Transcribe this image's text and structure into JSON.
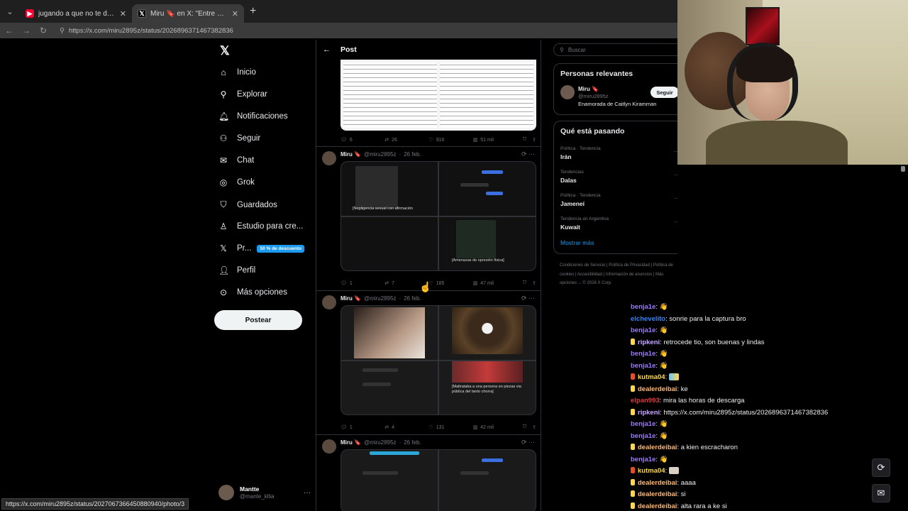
{
  "browser": {
    "tabs": [
      {
        "title": "jugando a que no te duele nada (\\",
        "active": false
      },
      {
        "title": "Miru 🔖 en X: \"Entre a tiktok y tu",
        "active": true
      }
    ],
    "url": "https://x.com/miru2895z/status/2026896371467382836",
    "status_url": "https://x.com/miru2895z/status/2027067366450880940/photo/3"
  },
  "nav": {
    "items": [
      {
        "label": "Inicio",
        "icon": "home-icon"
      },
      {
        "label": "Explorar",
        "icon": "search-icon"
      },
      {
        "label": "Notificaciones",
        "icon": "bell-icon"
      },
      {
        "label": "Seguir",
        "icon": "follow-icon"
      },
      {
        "label": "Chat",
        "icon": "mail-icon"
      },
      {
        "label": "Grok",
        "icon": "grok-icon"
      },
      {
        "label": "Guardados",
        "icon": "bookmark-icon"
      },
      {
        "label": "Estudio para cre...",
        "icon": "studio-icon"
      },
      {
        "label": "Pr...",
        "icon": "x-premium-icon"
      },
      {
        "label": "Perfil",
        "icon": "profile-icon"
      },
      {
        "label": "Más opciones",
        "icon": "more-icon"
      }
    ],
    "promo_badge": "50 % de descuento",
    "post_button": "Postear",
    "account_name": "Mantte",
    "account_handle": "@mante_kllia"
  },
  "feed": {
    "header_title": "Post",
    "first_actions": {
      "replies": "6",
      "reposts": "26",
      "likes": "916",
      "views": "51 mil"
    },
    "posts": [
      {
        "name": "Miru 🔖",
        "handle": "@miru2895z",
        "date": "26 feb.",
        "cap1": "[Negligencia sexual con afirmación",
        "cap2": "[Amenazas de opresión física]",
        "replies": "1",
        "reposts": "7",
        "likes": "185",
        "views": "47 mil"
      },
      {
        "name": "Miru 🔖",
        "handle": "@miru2895z",
        "date": "26 feb.",
        "cap1": "",
        "cap2": "[Maltrataba a una persona en piezas via pública del tanto chorra]",
        "replies": "1",
        "reposts": "4",
        "likes": "131",
        "views": "42 mil"
      },
      {
        "name": "Miru 🔖",
        "handle": "@miru2895z",
        "date": "26 feb."
      }
    ]
  },
  "right": {
    "search_placeholder": "Buscar",
    "relevant_title": "Personas relevantes",
    "relevant_name": "Miru 🔖",
    "relevant_handle": "@miru2895z",
    "relevant_bio": "Enamorada de Caitlyn Kiramman",
    "follow_label": "Seguir",
    "trending_title": "Qué está pasando",
    "trends": [
      {
        "context": "Política · Tendencia",
        "name": "Irán"
      },
      {
        "context": "Tendencias",
        "name": "Dalas"
      },
      {
        "context": "Política · Tendencia",
        "name": "Jameneí"
      },
      {
        "context": "Tendencia en Argentina",
        "name": "Kuwait"
      }
    ],
    "show_more": "Mostrar más",
    "footer": "Condiciones de Servicio  |  Política de Privacidad  |  Política de cookies  |  Accesibilidad  |  Información de anuncios  |  Más opciones ...  © 2026 X Corp."
  },
  "chat": {
    "messages": [
      {
        "user": "benja1e",
        "text": "👋",
        "color": "#9b7cf4"
      },
      {
        "user": "elchevelito",
        "text": "sonrie para la captura bro",
        "color": "#2e86ff"
      },
      {
        "user": "benja1e",
        "text": "👋",
        "color": "#9b7cf4"
      },
      {
        "user": "ripkeni",
        "text": "retrocede tio, son buenas y lindas",
        "color": "#c9a9ff"
      },
      {
        "user": "benja1e",
        "text": "👋",
        "color": "#9b7cf4"
      },
      {
        "user": "benja1e",
        "text": "👋",
        "color": "#9b7cf4"
      },
      {
        "user": "kutma04",
        "text": "",
        "color": "#ffd84a"
      },
      {
        "user": "dealerdeibai",
        "text": "ke",
        "color": "#ffb870"
      },
      {
        "user": "elpan993",
        "text": "mira las horas de descarga",
        "color": "#e03a3a"
      },
      {
        "user": "ripkeni",
        "text": "https://x.com/miru2895z/status/2026896371467382836",
        "color": "#c9a9ff"
      },
      {
        "user": "benja1e",
        "text": "👋",
        "color": "#9b7cf4"
      },
      {
        "user": "benja1e",
        "text": "👋",
        "color": "#9b7cf4"
      },
      {
        "user": "dealerdeibai",
        "text": "a kien escracharon",
        "color": "#ffb870"
      },
      {
        "user": "benja1e",
        "text": "👋",
        "color": "#9b7cf4"
      },
      {
        "user": "kutma04",
        "text": "",
        "color": "#ffd84a"
      },
      {
        "user": "dealerdeibai",
        "text": "aaaa",
        "color": "#ffb870"
      },
      {
        "user": "dealerdeibai",
        "text": "si",
        "color": "#ffb870"
      },
      {
        "user": "dealerdeibai",
        "text": "alta rara a ke si",
        "color": "#ffb870"
      }
    ]
  }
}
